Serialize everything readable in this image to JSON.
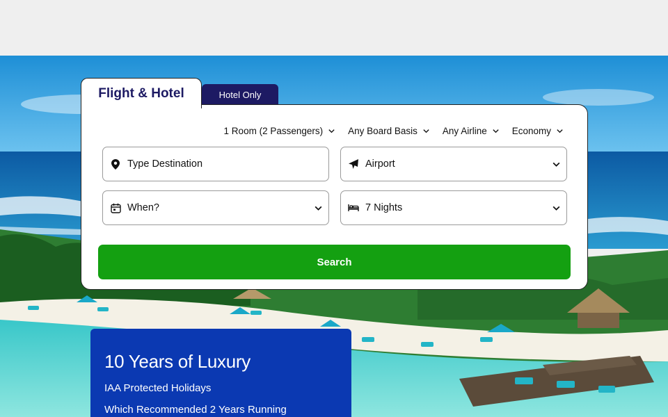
{
  "tabs": {
    "flight_hotel": "Flight & Hotel",
    "hotel_only": "Hotel Only"
  },
  "options": {
    "rooms": "1 Room (2 Passengers)",
    "board": "Any Board Basis",
    "airline": "Any Airline",
    "cabin": "Economy"
  },
  "fields": {
    "destination": "Type Destination",
    "airport": "Airport",
    "when": "When?",
    "nights": "7 Nights"
  },
  "search_label": "Search",
  "promo": {
    "title": "10 Years of Luxury",
    "line1": "IAA Protected Holidays",
    "line2": "Which Recommended 2 Years Running"
  },
  "colors": {
    "brand_navy": "#1d1a63",
    "search_green": "#14a011",
    "promo_blue": "#0b39b2"
  }
}
